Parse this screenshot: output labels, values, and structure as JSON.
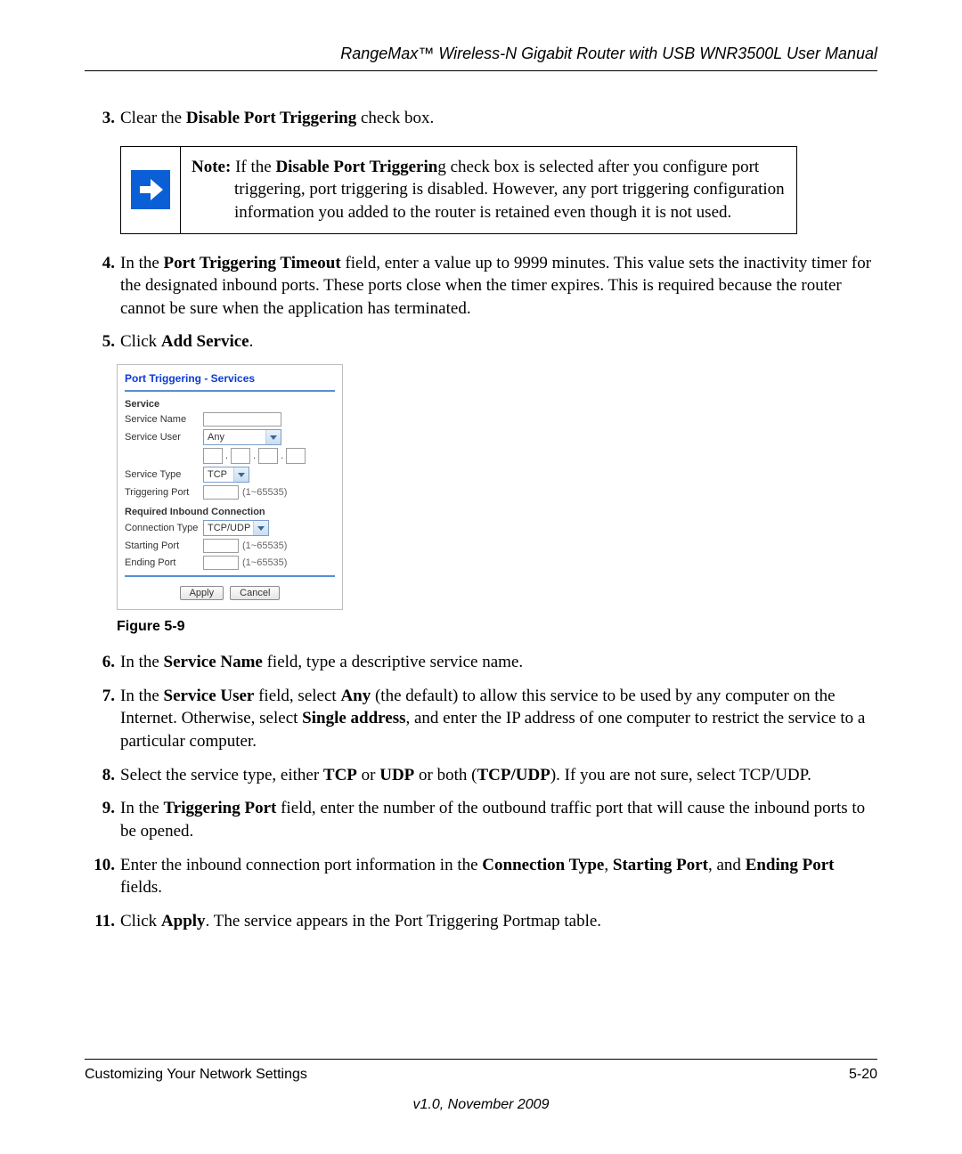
{
  "header": {
    "title": "RangeMax™ Wireless-N Gigabit Router with USB WNR3500L User Manual"
  },
  "steps": {
    "s3": {
      "num": "3.",
      "pre": "Clear the ",
      "bold": "Disable Port Triggering",
      "post": " check box."
    },
    "note": {
      "strong": "Note:",
      "line1_pre": " If the ",
      "line1_bold": "Disable Port Triggerin",
      "line1_post": "g check box is selected after you configure port",
      "rest": "triggering, port triggering is disabled. However, any port triggering configuration information you added to the router is retained even though it is not used."
    },
    "s4": {
      "num": "4.",
      "pre": "In the ",
      "bold": "Port Triggering Timeout",
      "post": " field, enter a value up to 9999 minutes. This value sets the inactivity timer for the designated inbound ports. These ports close when the timer expires. This is required because the router cannot be sure when the application has terminated."
    },
    "s5": {
      "num": "5.",
      "pre": "Click ",
      "bold": "Add Service",
      "post": "."
    },
    "s6": {
      "num": "6.",
      "pre": "In the ",
      "bold": "Service Name",
      "post": " field, type a descriptive service name."
    },
    "s7": {
      "num": "7.",
      "pre": "In the ",
      "bold1": "Service User",
      "mid1": " field, select ",
      "bold2": "Any",
      "mid2": " (the default) to allow this service to be used by any computer on the Internet. Otherwise, select ",
      "bold3": "Single address",
      "post": ", and enter the IP address of one computer to restrict the service to a particular computer."
    },
    "s8": {
      "num": "8.",
      "pre": "Select the service type, either ",
      "bold1": "TCP",
      "mid1": " or ",
      "bold2": "UDP",
      "mid2": " or both (",
      "bold3": "TCP/UDP",
      "post": "). If you are not sure, select TCP/UDP."
    },
    "s9": {
      "num": "9.",
      "pre": "In the ",
      "bold": "Triggering Port",
      "post": " field, enter the number of the outbound traffic port that will cause the inbound ports to be opened."
    },
    "s10": {
      "num": "10.",
      "pre": "Enter the inbound connection port information in the ",
      "bold1": "Connection Type",
      "mid1": ", ",
      "bold2": "Starting Port",
      "mid2": ", and ",
      "bold3": "Ending Port",
      "post": " fields."
    },
    "s11": {
      "num": "11.",
      "pre": "Click ",
      "bold": "Apply",
      "post": ". The service appears in the Port Triggering Portmap table."
    }
  },
  "mock": {
    "title": "Port Triggering - Services",
    "service_head": "Service",
    "labels": {
      "service_name": "Service Name",
      "service_user": "Service User",
      "service_type": "Service Type",
      "triggering_port": "Triggering Port",
      "required": "Required Inbound Connection",
      "connection_type": "Connection Type",
      "starting_port": "Starting Port",
      "ending_port": "Ending Port"
    },
    "values": {
      "service_user": "Any",
      "service_type": "TCP",
      "connection_type": "TCP/UDP",
      "range_hint": "(1~65535)"
    },
    "buttons": {
      "apply": "Apply",
      "cancel": "Cancel"
    },
    "caption": "Figure 5-9"
  },
  "footer": {
    "left": "Customizing Your Network Settings",
    "right": "5-20",
    "version": "v1.0, November 2009"
  }
}
